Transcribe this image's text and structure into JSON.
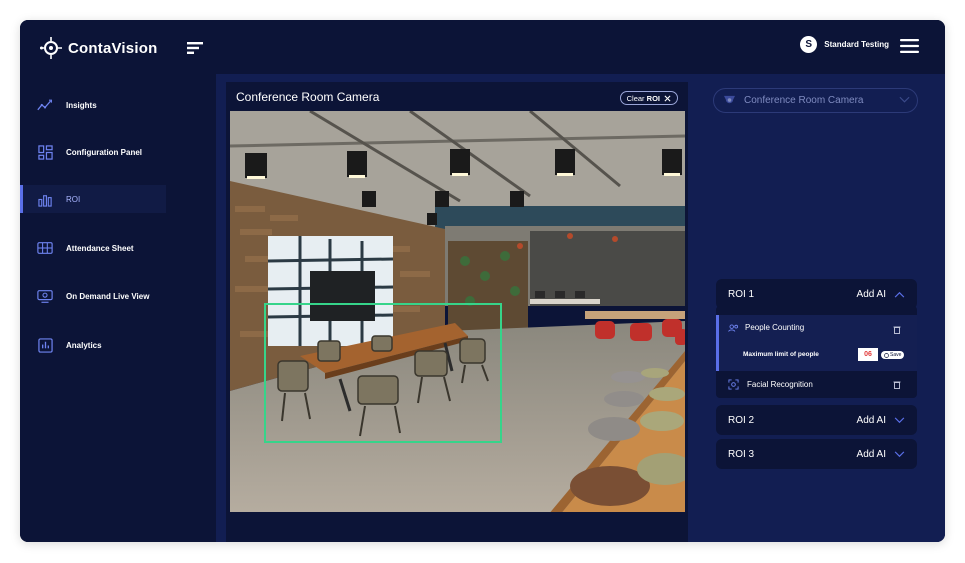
{
  "app": {
    "brand": "ContaVision",
    "user_initial": "S",
    "user_name": "Standard Testing"
  },
  "sidebar": {
    "items": [
      {
        "label": "Insights",
        "icon": "insights-icon",
        "active": false
      },
      {
        "label": "Configuration Panel",
        "icon": "configuration-icon",
        "active": false
      },
      {
        "label": "ROI",
        "icon": "roi-chart-icon",
        "active": true
      },
      {
        "label": "Attendance Sheet",
        "icon": "attendance-grid-icon",
        "active": false
      },
      {
        "label": "On Demand Live View",
        "icon": "live-view-icon",
        "active": false
      },
      {
        "label": "Analytics",
        "icon": "analytics-icon",
        "active": false
      }
    ]
  },
  "camera": {
    "title": "Conference Room Camera",
    "clear_prefix": "Clear",
    "clear_bold": "ROI"
  },
  "right_panel": {
    "camera_select": "Conference Room Camera",
    "rois": [
      {
        "name": "ROI 1",
        "add_label": "Add AI",
        "expanded": true
      },
      {
        "name": "ROI 2",
        "add_label": "Add AI",
        "expanded": false
      },
      {
        "name": "ROI 3",
        "add_label": "Add AI",
        "expanded": false
      }
    ],
    "people_counting": {
      "label": "People Counting",
      "max_label": "Maximum limit of people",
      "max_value": "06",
      "save_label": "Save"
    },
    "facial_recognition": {
      "label": "Facial Recognition"
    }
  },
  "colors": {
    "app_bg": "#0d1538",
    "main_bg": "#121e52",
    "accent": "#5a6fe8",
    "roi_outline": "#36d48a",
    "limit_value": "#e23b3b"
  }
}
